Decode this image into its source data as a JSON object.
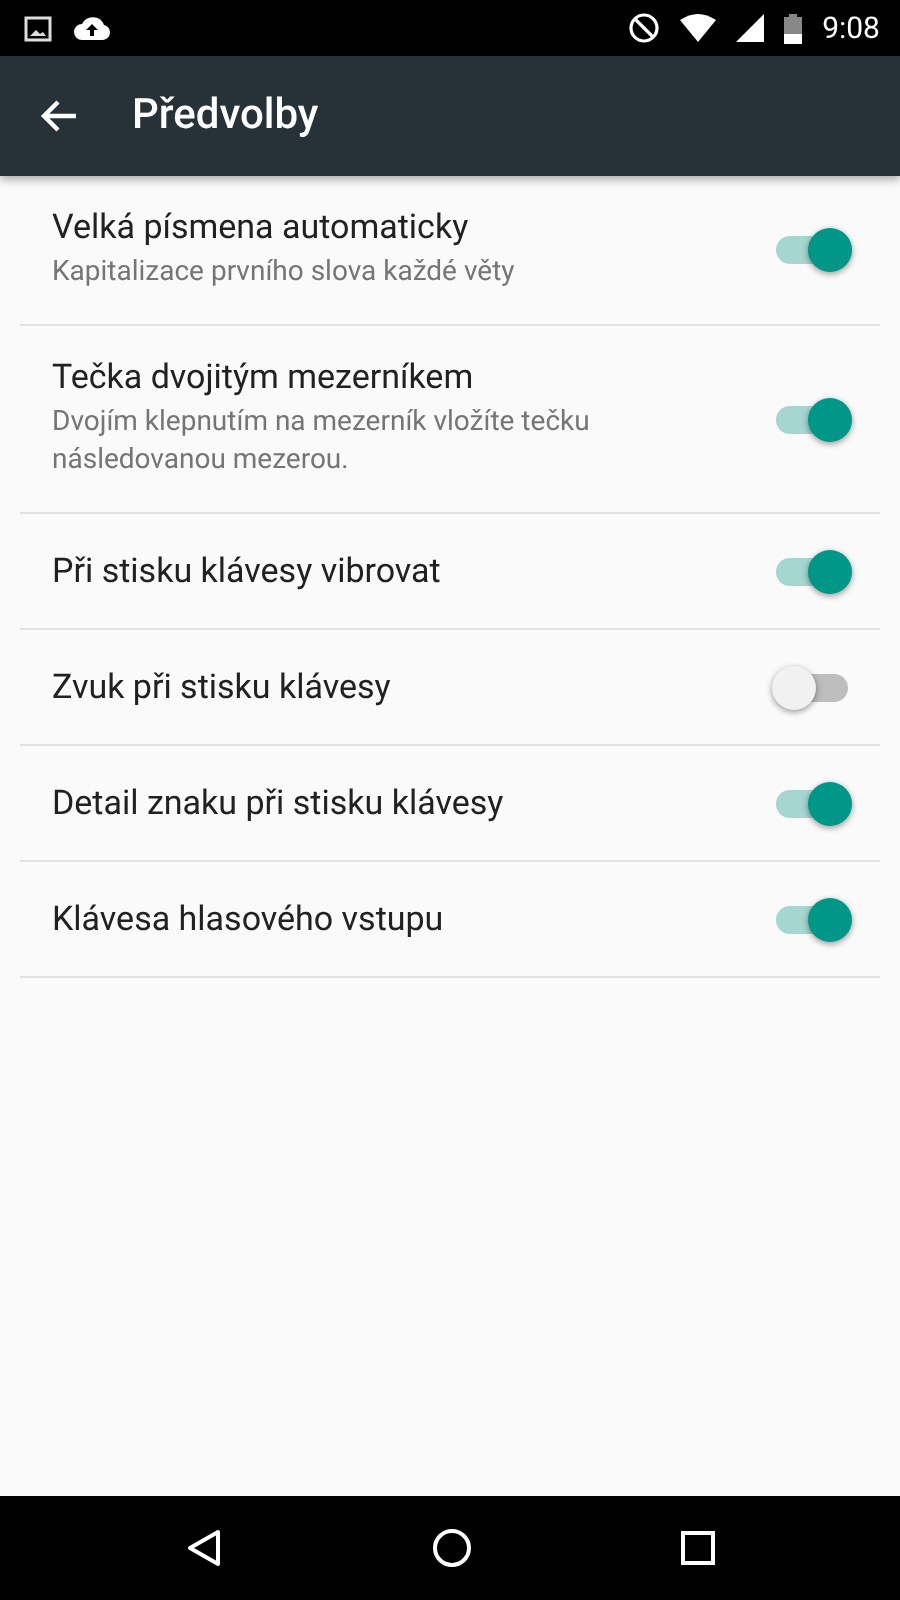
{
  "status_bar": {
    "time": "9:08"
  },
  "toolbar": {
    "title": "Předvolby"
  },
  "settings": [
    {
      "title": "Velká písmena automaticky",
      "summary": "Kapitalizace prvního slova každé věty",
      "on": true
    },
    {
      "title": "Tečka dvojitým mezerníkem",
      "summary": "Dvojím klepnutím na mezerník vložíte tečku následovanou mezerou.",
      "on": true
    },
    {
      "title": "Při stisku klávesy vibrovat",
      "on": true
    },
    {
      "title": "Zvuk při stisku klávesy",
      "on": false
    },
    {
      "title": "Detail znaku při stisku klávesy",
      "on": true
    },
    {
      "title": "Klávesa hlasového vstupu",
      "on": true
    }
  ]
}
